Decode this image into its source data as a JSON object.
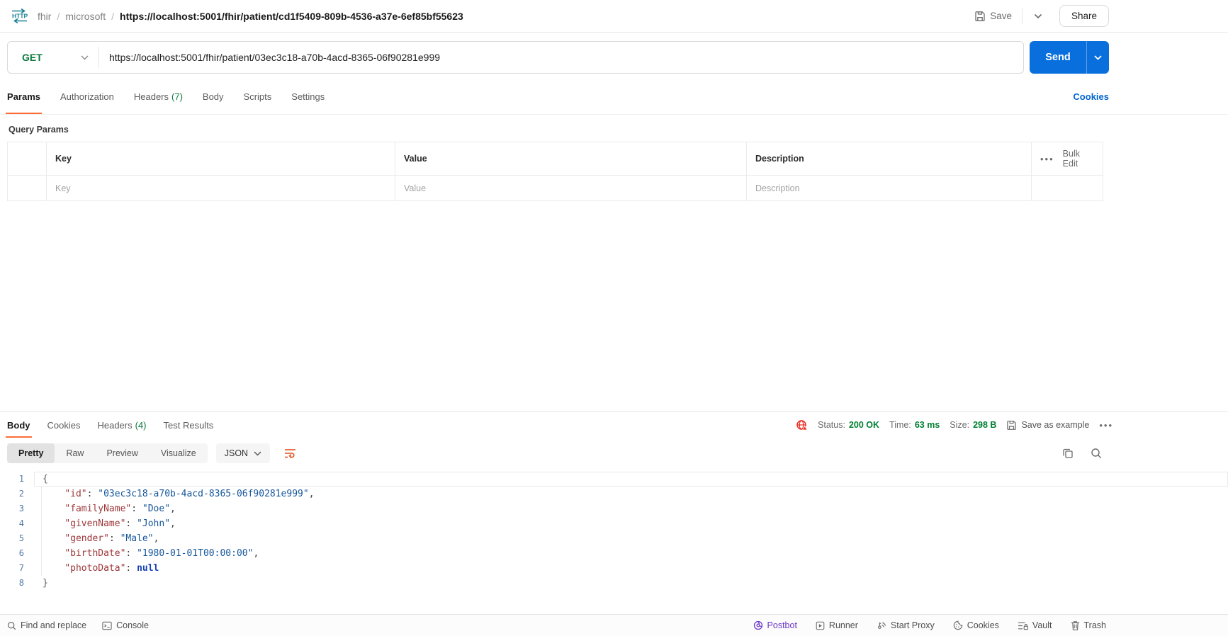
{
  "topbar": {
    "breadcrumb": [
      {
        "label": "fhir"
      },
      {
        "label": "microsoft"
      }
    ],
    "breadcrumb_current": "https://localhost:5001/fhir/patient/cd1f5409-809b-4536-a37e-6ef85bf55623",
    "separator": "/",
    "save_label": "Save",
    "share_label": "Share"
  },
  "request": {
    "method": "GET",
    "url": "https://localhost:5001/fhir/patient/03ec3c18-a70b-4acd-8365-06f90281e999",
    "send_label": "Send",
    "tabs": [
      {
        "label": "Params"
      },
      {
        "label": "Authorization"
      },
      {
        "label": "Headers",
        "count": "(7)"
      },
      {
        "label": "Body"
      },
      {
        "label": "Scripts"
      },
      {
        "label": "Settings"
      }
    ],
    "cookies_link": "Cookies",
    "query_params": {
      "title": "Query Params",
      "columns": [
        "Key",
        "Value",
        "Description"
      ],
      "bulk_edit_label": "Bulk Edit",
      "row_placeholders": [
        "Key",
        "Value",
        "Description"
      ]
    }
  },
  "response": {
    "tabs": [
      {
        "label": "Body"
      },
      {
        "label": "Cookies"
      },
      {
        "label": "Headers",
        "count": "(4)"
      },
      {
        "label": "Test Results"
      }
    ],
    "meta": {
      "status_label": "Status:",
      "status_value": "200 OK",
      "time_label": "Time:",
      "time_value": "63 ms",
      "size_label": "Size:",
      "size_value": "298 B",
      "save_as_example_label": "Save as example"
    },
    "view_tabs": [
      "Pretty",
      "Raw",
      "Preview",
      "Visualize"
    ],
    "view_selected": "Pretty",
    "language": "JSON",
    "code_lines": [
      {
        "num": "1",
        "text": "{"
      },
      {
        "num": "2",
        "indent": "    ",
        "key": "\"id\"",
        "colon": ": ",
        "value": "\"03ec3c18-a70b-4acd-8365-06f90281e999\"",
        "comma": ","
      },
      {
        "num": "3",
        "indent": "    ",
        "key": "\"familyName\"",
        "colon": ": ",
        "value": "\"Doe\"",
        "comma": ","
      },
      {
        "num": "4",
        "indent": "    ",
        "key": "\"givenName\"",
        "colon": ": ",
        "value": "\"John\"",
        "comma": ","
      },
      {
        "num": "5",
        "indent": "    ",
        "key": "\"gender\"",
        "colon": ": ",
        "value": "\"Male\"",
        "comma": ","
      },
      {
        "num": "6",
        "indent": "    ",
        "key": "\"birthDate\"",
        "colon": ": ",
        "value": "\"1980-01-01T00:00:00\"",
        "comma": ","
      },
      {
        "num": "7",
        "indent": "    ",
        "key": "\"photoData\"",
        "colon": ": ",
        "value": "null"
      },
      {
        "num": "8",
        "text": "}"
      }
    ]
  },
  "footer": {
    "find_replace_label": "Find and replace",
    "console_label": "Console",
    "postbot_label": "Postbot",
    "runner_label": "Runner",
    "start_proxy_label": "Start Proxy",
    "cookies_label": "Cookies",
    "vault_label": "Vault",
    "trash_label": "Trash"
  },
  "icons": {
    "more": "•••"
  },
  "colors": {
    "accent_orange": "#FF6C37",
    "method_green": "#0B7A3E",
    "success_green": "#007F31",
    "link_blue": "#0265D2",
    "send_blue": "#086FDD",
    "postbot_purple": "#6B35C9",
    "http_icon_teal": "#1A7F94",
    "json_key_red": "#9E3538",
    "json_string_blue": "#15569B"
  }
}
